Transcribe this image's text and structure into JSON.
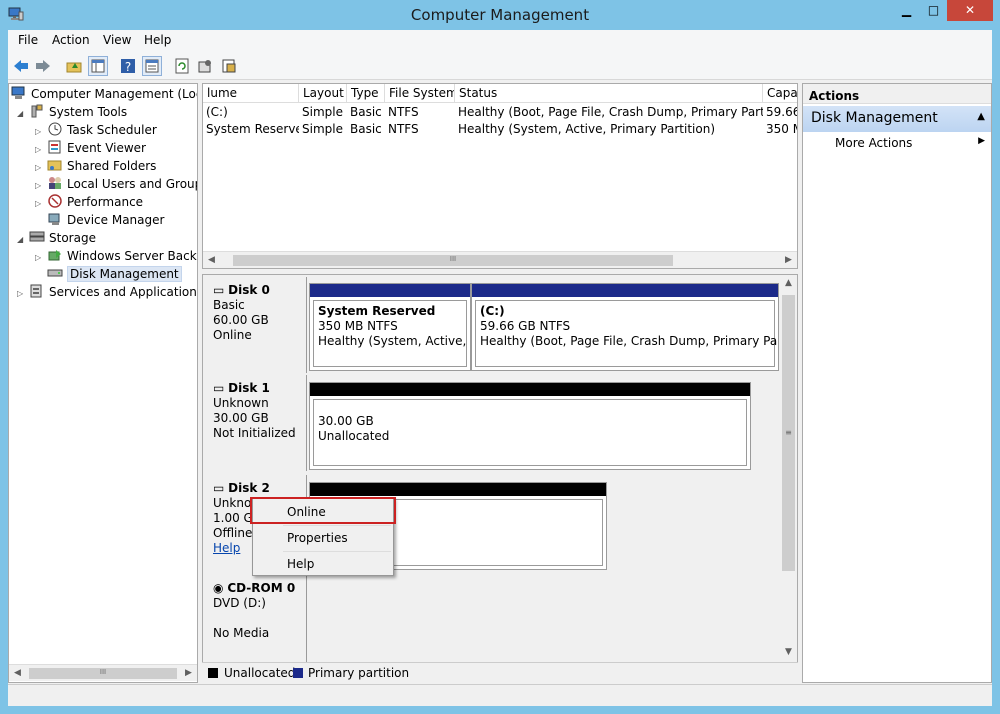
{
  "window": {
    "title": "Computer Management",
    "minimize_glyph": "▁",
    "maximize_glyph": "□",
    "close_glyph": "✕"
  },
  "menubar": {
    "items": [
      "File",
      "Action",
      "View",
      "Help"
    ]
  },
  "toolbar": {
    "icons": [
      "back-arrow-icon",
      "forward-arrow-icon",
      "up-folder-icon",
      "show-hide-tree-icon",
      "help-icon",
      "properties-icon",
      "refresh-icon",
      "settings-icon",
      "export-icon"
    ]
  },
  "tree": {
    "items": [
      {
        "label": "Computer Management (Local",
        "icon": "computer-icon",
        "expander": ""
      },
      {
        "label": "System Tools",
        "icon": "tools-icon",
        "expander": "◢"
      },
      {
        "label": "Task Scheduler",
        "icon": "clock-icon",
        "expander": "▷"
      },
      {
        "label": "Event Viewer",
        "icon": "event-viewer-icon",
        "expander": "▷"
      },
      {
        "label": "Shared Folders",
        "icon": "shared-folder-icon",
        "expander": "▷"
      },
      {
        "label": "Local Users and Groups",
        "icon": "users-icon",
        "expander": "▷"
      },
      {
        "label": "Performance",
        "icon": "performance-icon",
        "expander": "▷"
      },
      {
        "label": "Device Manager",
        "icon": "device-manager-icon",
        "expander": ""
      },
      {
        "label": "Storage",
        "icon": "storage-icon",
        "expander": "◢"
      },
      {
        "label": "Windows Server Backup",
        "icon": "backup-icon",
        "expander": "▷"
      },
      {
        "label": "Disk Management",
        "icon": "disk-management-icon",
        "expander": ""
      },
      {
        "label": "Services and Applications",
        "icon": "services-icon",
        "expander": "▷"
      }
    ]
  },
  "volume_list": {
    "headers": [
      "lume",
      "Layout",
      "Type",
      "File System",
      "Status",
      "Capa"
    ],
    "rows": [
      [
        "(C:)",
        "Simple",
        "Basic",
        "NTFS",
        "Healthy (Boot, Page File, Crash Dump, Primary Partition)",
        "59.66"
      ],
      [
        "System Reserved",
        "Simple",
        "Basic",
        "NTFS",
        "Healthy (System, Active, Primary Partition)",
        "350 M"
      ]
    ],
    "scroll_grip": "III"
  },
  "disks": {
    "disk0": {
      "name": "Disk 0",
      "type": "Basic",
      "size": "60.00 GB",
      "state": "Online",
      "partitions": [
        {
          "title": "System Reserved",
          "size": "350 MB NTFS",
          "status": "Healthy (System, Active, Pri"
        },
        {
          "title": "(C:)",
          "size": "59.66 GB NTFS",
          "status": "Healthy (Boot, Page File, Crash Dump, Primary Partition"
        }
      ]
    },
    "disk1": {
      "name": "Disk 1",
      "type": "Unknown",
      "size": "30.00 GB",
      "state": "Not Initialized",
      "part_size": "30.00 GB",
      "part_status": "Unallocated"
    },
    "disk2": {
      "name": "Disk 2",
      "type": "Unknow",
      "size": "1.00 GB",
      "state": "Offline",
      "help": "Help"
    },
    "cdrom0": {
      "name": "CD-ROM 0",
      "type": "DVD (D:)",
      "state": "No Media"
    }
  },
  "legend": {
    "unallocated": "Unallocated",
    "primary": "Primary partition"
  },
  "actions": {
    "title": "Actions",
    "section": "Disk Management",
    "more": "More Actions"
  },
  "context_menu": {
    "items": [
      "Online",
      "Properties",
      "Help"
    ]
  },
  "colors": {
    "primary_partition": "#1c2a8a",
    "unallocated": "#000000",
    "titlebar": "#7ec3e6",
    "highlight": "#cc2222"
  }
}
